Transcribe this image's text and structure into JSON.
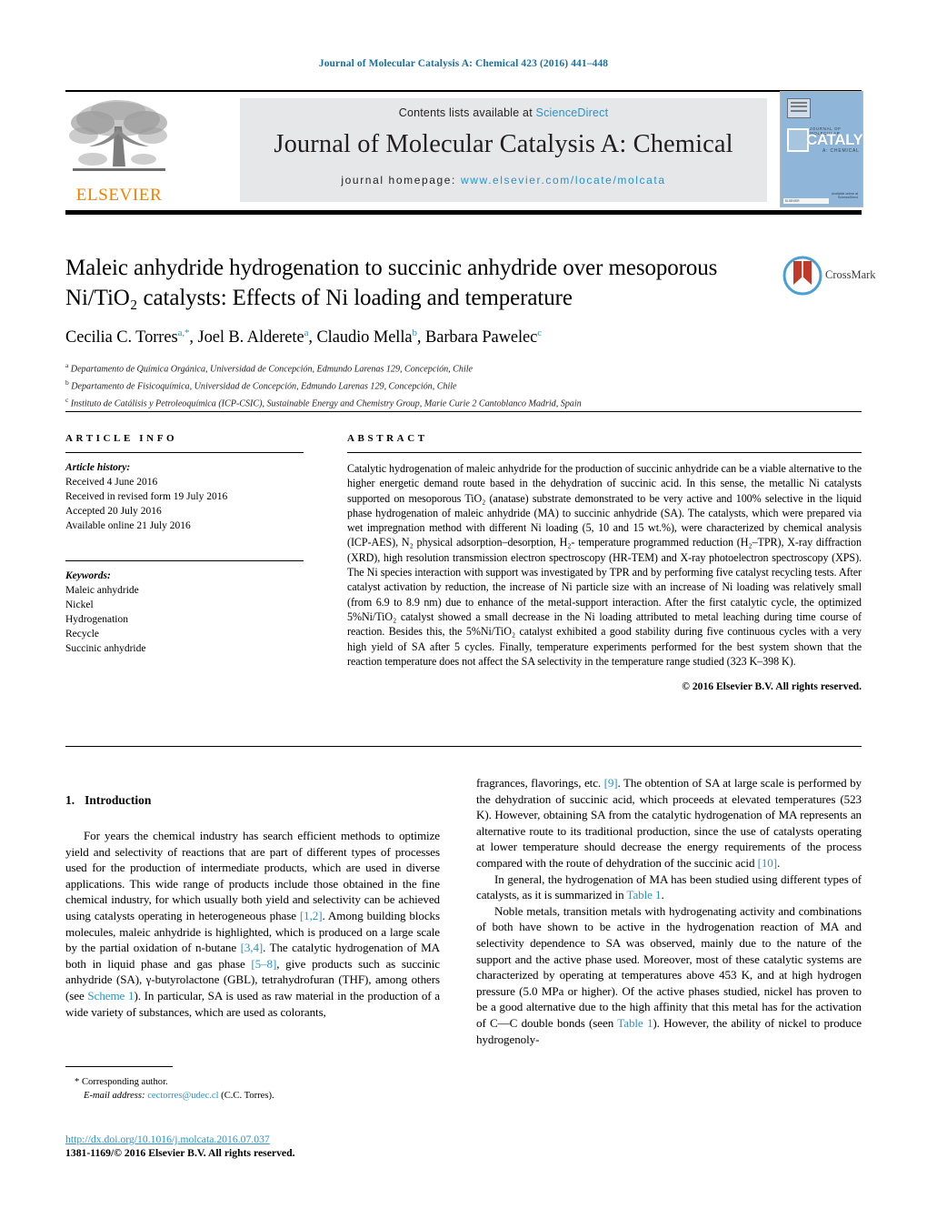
{
  "running_head": "Journal of Molecular Catalysis A: Chemical 423 (2016) 441–448",
  "masthead": {
    "publisher": "ELSEVIER",
    "contents_prefix": "Contents lists available at ",
    "contents_link": "ScienceDirect",
    "journal_title": "Journal of Molecular Catalysis A: Chemical",
    "homepage_prefix": "journal homepage: ",
    "homepage_url": "www.elsevier.com/locate/molcata",
    "cover": {
      "sub": "JOURNAL OF MOLECULAR",
      "main": "CATALYSIS",
      "chem": "A: CHEMICAL",
      "foot_right": "Available online at\nScienceDirect",
      "foot_left": "ELSEVIER"
    }
  },
  "article": {
    "title": "Maleic anhydride hydrogenation to succinic anhydride over mesoporous Ni/TiO₂ catalysts: Effects of Ni loading and temperature",
    "authors": [
      {
        "name": "Cecilia C. Torres",
        "marks": "a,*"
      },
      {
        "name": "Joel B. Alderete",
        "marks": "a"
      },
      {
        "name": "Claudio Mella",
        "marks": "b"
      },
      {
        "name": "Barbara Pawelec",
        "marks": "c"
      }
    ],
    "affiliations": [
      {
        "mark": "a",
        "text": "Departamento de Química Orgánica, Universidad de Concepción, Edmundo Larenas 129, Concepción, Chile"
      },
      {
        "mark": "b",
        "text": "Departamento de Fisicoquímica, Universidad de Concepción, Edmundo Larenas 129, Concepción, Chile"
      },
      {
        "mark": "c",
        "text": "Instituto de Catálisis y Petroleoquímica (ICP-CSIC), Sustainable Energy and Chemistry Group, Marie Curie 2 Cantoblanco Madrid, Spain"
      }
    ],
    "crossmark_label": "CrossMark"
  },
  "article_info": {
    "heading": "ARTICLE INFO",
    "history_label": "Article history:",
    "history": [
      "Received 4 June 2016",
      "Received in revised form 19 July 2016",
      "Accepted 20 July 2016",
      "Available online 21 July 2016"
    ],
    "keywords_label": "Keywords:",
    "keywords": [
      "Maleic anhydride",
      "Nickel",
      "Hydrogenation",
      "Recycle",
      "Succinic anhydride"
    ]
  },
  "abstract": {
    "heading": "ABSTRACT",
    "text": "Catalytic hydrogenation of maleic anhydride for the production of succinic anhydride can be a viable alternative to the higher energetic demand route based in the dehydration of succinic acid. In this sense, the metallic Ni catalysts supported on mesoporous TiO₂ (anatase) substrate demonstrated to be very active and 100% selective in the liquid phase hydrogenation of maleic anhydride (MA) to succinic anhydride (SA). The catalysts, which were prepared via wet impregnation method with different Ni loading (5, 10 and 15 wt.%), were characterized by chemical analysis (ICP-AES), N₂ physical adsorption–desorption, H₂- temperature programmed reduction (H₂–TPR), X-ray diffraction (XRD), high resolution transmission electron spectroscopy (HR-TEM) and X-ray photoelectron spectroscopy (XPS). The Ni species interaction with support was investigated by TPR and by performing five catalyst recycling tests. After catalyst activation by reduction, the increase of Ni particle size with an increase of Ni loading was relatively small (from 6.9 to 8.9 nm) due to enhance of the metal-support interaction. After the first catalytic cycle, the optimized 5%Ni/TiO₂ catalyst showed a small decrease in the Ni loading attributed to metal leaching during time course of reaction. Besides this, the 5%Ni/TiO₂ catalyst exhibited a good stability during five continuous cycles with a very high yield of SA after 5 cycles. Finally, temperature experiments performed for the best system shown that the reaction temperature does not affect the SA selectivity in the temperature range studied (323 K–398 K).",
    "copyright": "© 2016 Elsevier B.V. All rights reserved."
  },
  "body": {
    "section_number": "1.",
    "section_title": "Introduction",
    "left_paragraph_1_a": "For years the chemical industry has search efficient methods to optimize yield and selectivity of reactions that are part of different types of processes used for the production of intermediate products, which are used in diverse applications. This wide range of products include those obtained in the fine chemical industry, for which usually both yield and selectivity can be achieved using catalysts operating in heterogeneous phase ",
    "ref_1_2": "[1,2]",
    "left_paragraph_1_b": ". Among building blocks molecules, maleic anhydride is highlighted, which is produced on a large scale by the partial oxidation of n-butane ",
    "ref_3_4": "[3,4]",
    "left_paragraph_1_c": ". The catalytic hydrogenation of MA both in liquid phase and gas phase ",
    "ref_5_8": "[5–8]",
    "left_paragraph_1_d": ", give products such as succinic anhydride (SA), γ-butyrolactone (GBL), tetrahydrofuran (THF), among others (see ",
    "ref_scheme1": "Scheme 1",
    "left_paragraph_1_e": "). In particular, SA is used as raw material in the production of a wide variety of substances, which are used as colorants,",
    "right_paragraph_1_a": "fragrances, flavorings, etc. ",
    "ref_9": "[9]",
    "right_paragraph_1_b": ". The obtention of SA at large scale is performed by the dehydration of succinic acid, which proceeds at elevated temperatures (523 K). However, obtaining SA from the catalytic hydrogenation of MA represents an alternative route to its traditional production, since the use of catalysts operating at lower temperature should decrease the energy requirements of the process compared with the route of dehydration of the succinic acid ",
    "ref_10": "[10]",
    "right_paragraph_1_c": ".",
    "right_paragraph_2_a": "In general, the hydrogenation of MA has been studied using different types of catalysts, as it is summarized in ",
    "ref_table1_a": "Table 1",
    "right_paragraph_2_b": ".",
    "right_paragraph_3_a": "Noble metals, transition metals with hydrogenating activity and combinations of both have shown to be active in the hydrogenation reaction of MA and selectivity dependence to SA was observed, mainly due to the nature of the support and the active phase used. Moreover, most of these catalytic systems are characterized by operating at temperatures above 453 K, and at high hydrogen pressure (5.0 MPa or higher). Of the active phases studied, nickel has proven to be a good alternative due to the high affinity that this metal has for the activation of C—C double bonds (seen ",
    "ref_table1_b": "Table 1",
    "right_paragraph_3_b": "). However, the ability of nickel to produce hydrogenoly-"
  },
  "footnote": {
    "corresponding": "* Corresponding author.",
    "email_label": "E-mail address:",
    "email": "cectorres@udec.cl",
    "email_suffix": "(C.C. Torres).",
    "doi": "http://dx.doi.org/10.1016/j.molcata.2016.07.037",
    "issn": "1381-1169/© 2016 Elsevier B.V. All rights reserved."
  },
  "colors": {
    "link": "#2a93c9",
    "running_head": "#1a6fa3",
    "elsevier_orange": "#ef8200",
    "banner_bg": "#e6e7e8"
  }
}
